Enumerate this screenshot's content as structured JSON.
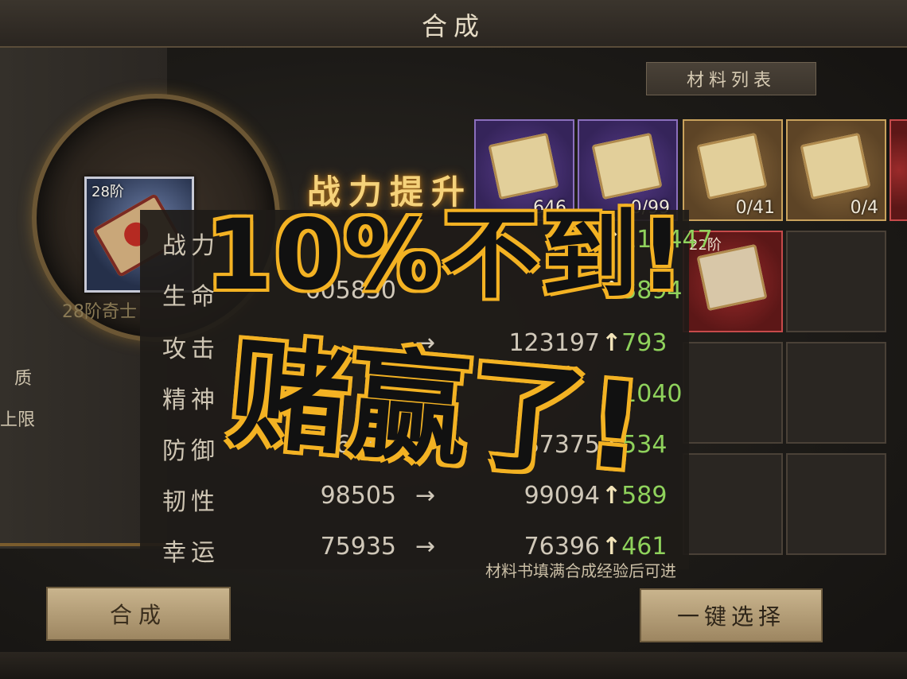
{
  "header": {
    "title": "合成"
  },
  "left": {
    "item_tier": "28阶",
    "item_name": "28阶奇士",
    "labels": [
      "质",
      "上限"
    ]
  },
  "materials": {
    "title": "材料列表",
    "slots": [
      {
        "rarity": "purple",
        "count": "646"
      },
      {
        "rarity": "purple",
        "count": "0/99"
      },
      {
        "rarity": "gold",
        "count": "0/41"
      },
      {
        "rarity": "gold",
        "count": "0/4"
      },
      {
        "rarity": "red",
        "tier": "22阶"
      }
    ]
  },
  "stats": {
    "title": "战力提升",
    "rows": [
      {
        "name": "战力",
        "old": "",
        "new": "",
        "inc": "114447"
      },
      {
        "name": "生命",
        "old": "605830",
        "new": "",
        "inc": "3894"
      },
      {
        "name": "攻击",
        "old": "",
        "new": "123197",
        "inc": "793"
      },
      {
        "name": "精神",
        "old": "",
        "new": "",
        "inc": "1040"
      },
      {
        "name": "防御",
        "old": "86841",
        "new": "87375",
        "inc": "534"
      },
      {
        "name": "韧性",
        "old": "98505",
        "new": "99094",
        "inc": "589"
      },
      {
        "name": "幸运",
        "old": "75935",
        "new": "76396",
        "inc": "461"
      }
    ],
    "arrow": "→",
    "up": "↑"
  },
  "hint": "材料书填满合成经验后可进",
  "buttons": {
    "synth": "合成",
    "auto_select": "一键选择"
  },
  "overlay": {
    "line1": "10%不到!",
    "line2": "赌赢了!"
  },
  "colors": {
    "accent": "#f3b223",
    "increase": "#8fd25c",
    "boost_title": "#f5d27a"
  }
}
